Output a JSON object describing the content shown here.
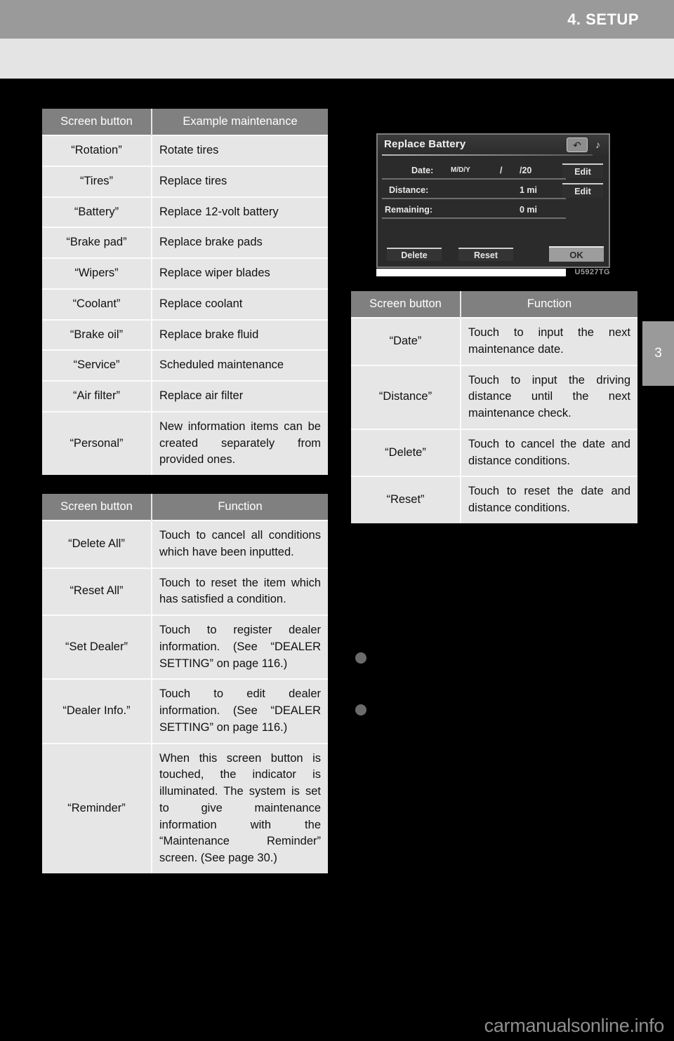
{
  "header": {
    "chapter_title": "4. SETUP",
    "chapter_tab_number": "3"
  },
  "maintenance_table": {
    "columns": [
      "Screen button",
      "Example maintenance"
    ],
    "rows": [
      {
        "button": "“Rotation”",
        "maintenance": "Rotate tires"
      },
      {
        "button": "“Tires”",
        "maintenance": "Replace tires"
      },
      {
        "button": "“Battery”",
        "maintenance": "Replace 12-volt battery"
      },
      {
        "button": "“Brake pad”",
        "maintenance": "Replace brake pads"
      },
      {
        "button": "“Wipers”",
        "maintenance": "Replace wiper blades"
      },
      {
        "button": "“Coolant”",
        "maintenance": "Replace coolant"
      },
      {
        "button": "“Brake oil”",
        "maintenance": "Replace brake fluid"
      },
      {
        "button": "“Service”",
        "maintenance": "Scheduled maintenance"
      },
      {
        "button": "“Air filter”",
        "maintenance": "Replace air filter"
      },
      {
        "button": "“Personal”",
        "maintenance": "New information items can be created separately from provided ones."
      }
    ]
  },
  "function_table_left": {
    "columns": [
      "Screen button",
      "Function"
    ],
    "rows": [
      {
        "button": "“Delete All”",
        "function": "Touch to cancel all conditions which have been inputted."
      },
      {
        "button": "“Reset All”",
        "function": "Touch to reset the item which has satisfied a condition."
      },
      {
        "button": "“Set Dealer”",
        "function": "Touch to register dealer information. (See “DEALER SETTING” on page 116.)"
      },
      {
        "button": "“Dealer Info.”",
        "function": "Touch to edit dealer information. (See “DEALER SETTING” on page 116.)"
      },
      {
        "button": "“Reminder”",
        "function": "When this screen button is touched, the indicator is illuminated. The system is set to give maintenance information with the “Maintenance Reminder” screen. (See page 30.)"
      }
    ]
  },
  "function_table_right": {
    "columns": [
      "Screen button",
      "Function"
    ],
    "rows": [
      {
        "button": "“Date”",
        "function": "Touch to input the next maintenance date."
      },
      {
        "button": "“Distance”",
        "function": "Touch to input the driving distance until the next maintenance check."
      },
      {
        "button": "“Delete”",
        "function": "Touch to cancel the date and distance conditions."
      },
      {
        "button": "“Reset”",
        "function": "Touch to reset the date and distance conditions."
      }
    ]
  },
  "nav_figure": {
    "title": "Replace Battery",
    "back_icon": "back-arrow-icon",
    "note_icon": "♪",
    "rows": [
      {
        "label": "Date:",
        "middle": "M/D/Y",
        "separator": "/",
        "value": "/20",
        "edit_label": "Edit"
      },
      {
        "label": "Distance:",
        "middle": "",
        "separator": "",
        "value": "1 mi",
        "edit_label": "Edit"
      },
      {
        "label": "Remaining:",
        "middle": "",
        "separator": "",
        "value": "0 mi",
        "edit_label": ""
      }
    ],
    "delete_label": "Delete",
    "reset_label": "Reset",
    "ok_label": "OK",
    "figure_code": "U5927TG"
  },
  "bullets": [
    {
      "text": ""
    },
    {
      "text": ""
    }
  ],
  "footer": {
    "watermark": "carmanualsonline.info"
  },
  "colors": {
    "header_gray": "#9a9a9a",
    "subheader_gray": "#e4e4e4",
    "table_header_gray": "#808080",
    "table_body_gray": "#e6e6e6",
    "page_background": "#000000",
    "watermark_gray": "#8f8f8f"
  }
}
